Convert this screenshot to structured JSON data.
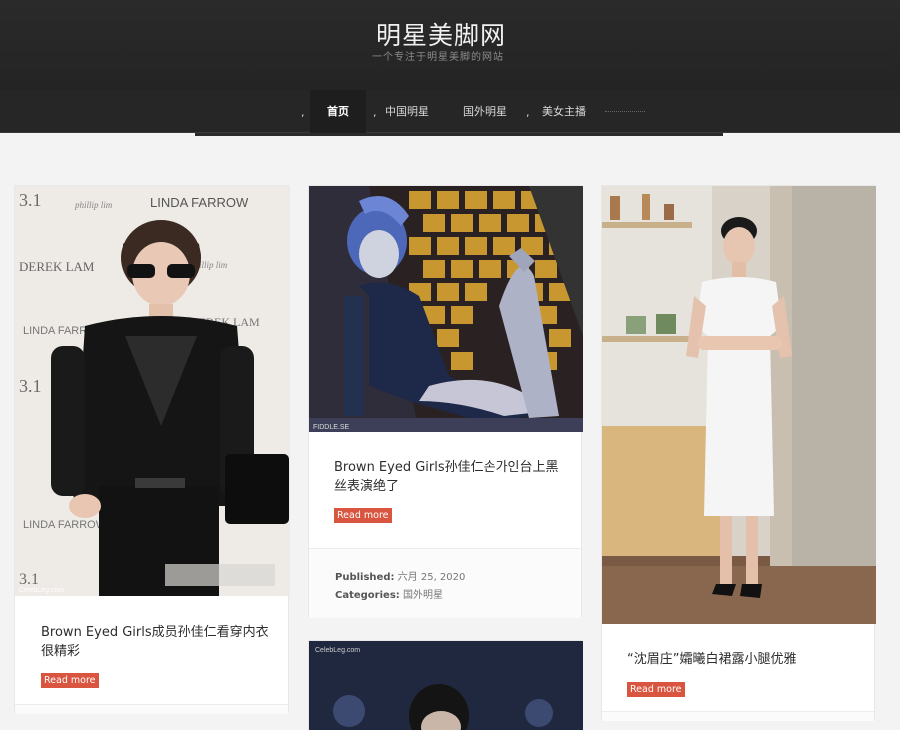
{
  "header": {
    "site_title": "明星美脚网",
    "tagline": "一个专注于明星美脚的网站"
  },
  "nav": {
    "separator": ",",
    "items": [
      {
        "label": "首页",
        "active": true
      },
      {
        "label": "中国明星",
        "active": false
      },
      {
        "label": "国外明星",
        "active": false
      },
      {
        "label": "美女主播",
        "active": false
      }
    ]
  },
  "posts": [
    {
      "title": "Brown Eyed Girls成员孙佳仁看穿内衣很精彩",
      "read_more": "Read more",
      "image_text": {
        "a": "3.1",
        "b": "LINDA FARROW",
        "c": "DEREK LAM",
        "d": "phillip lim",
        "e": "CelebLeg.com"
      }
    },
    {
      "title": "Brown Eyed Girls孙佳仁손가인台上黑丝表演绝了",
      "read_more": "Read more",
      "published_label": "Published:",
      "published_value": "六月 25, 2020",
      "categories_label": "Categories:",
      "categories_value": "国外明星",
      "image_text": {
        "watermark": "FIDDLE.SE"
      }
    },
    {
      "title": "“沈眉庄”孀曦白裙露小腿优雅",
      "read_more": "Read more"
    },
    {
      "image_text": {
        "watermark": "CelebLeg.com"
      }
    }
  ],
  "colors": {
    "header_bg": "#262626",
    "accent": "#d9553f"
  }
}
